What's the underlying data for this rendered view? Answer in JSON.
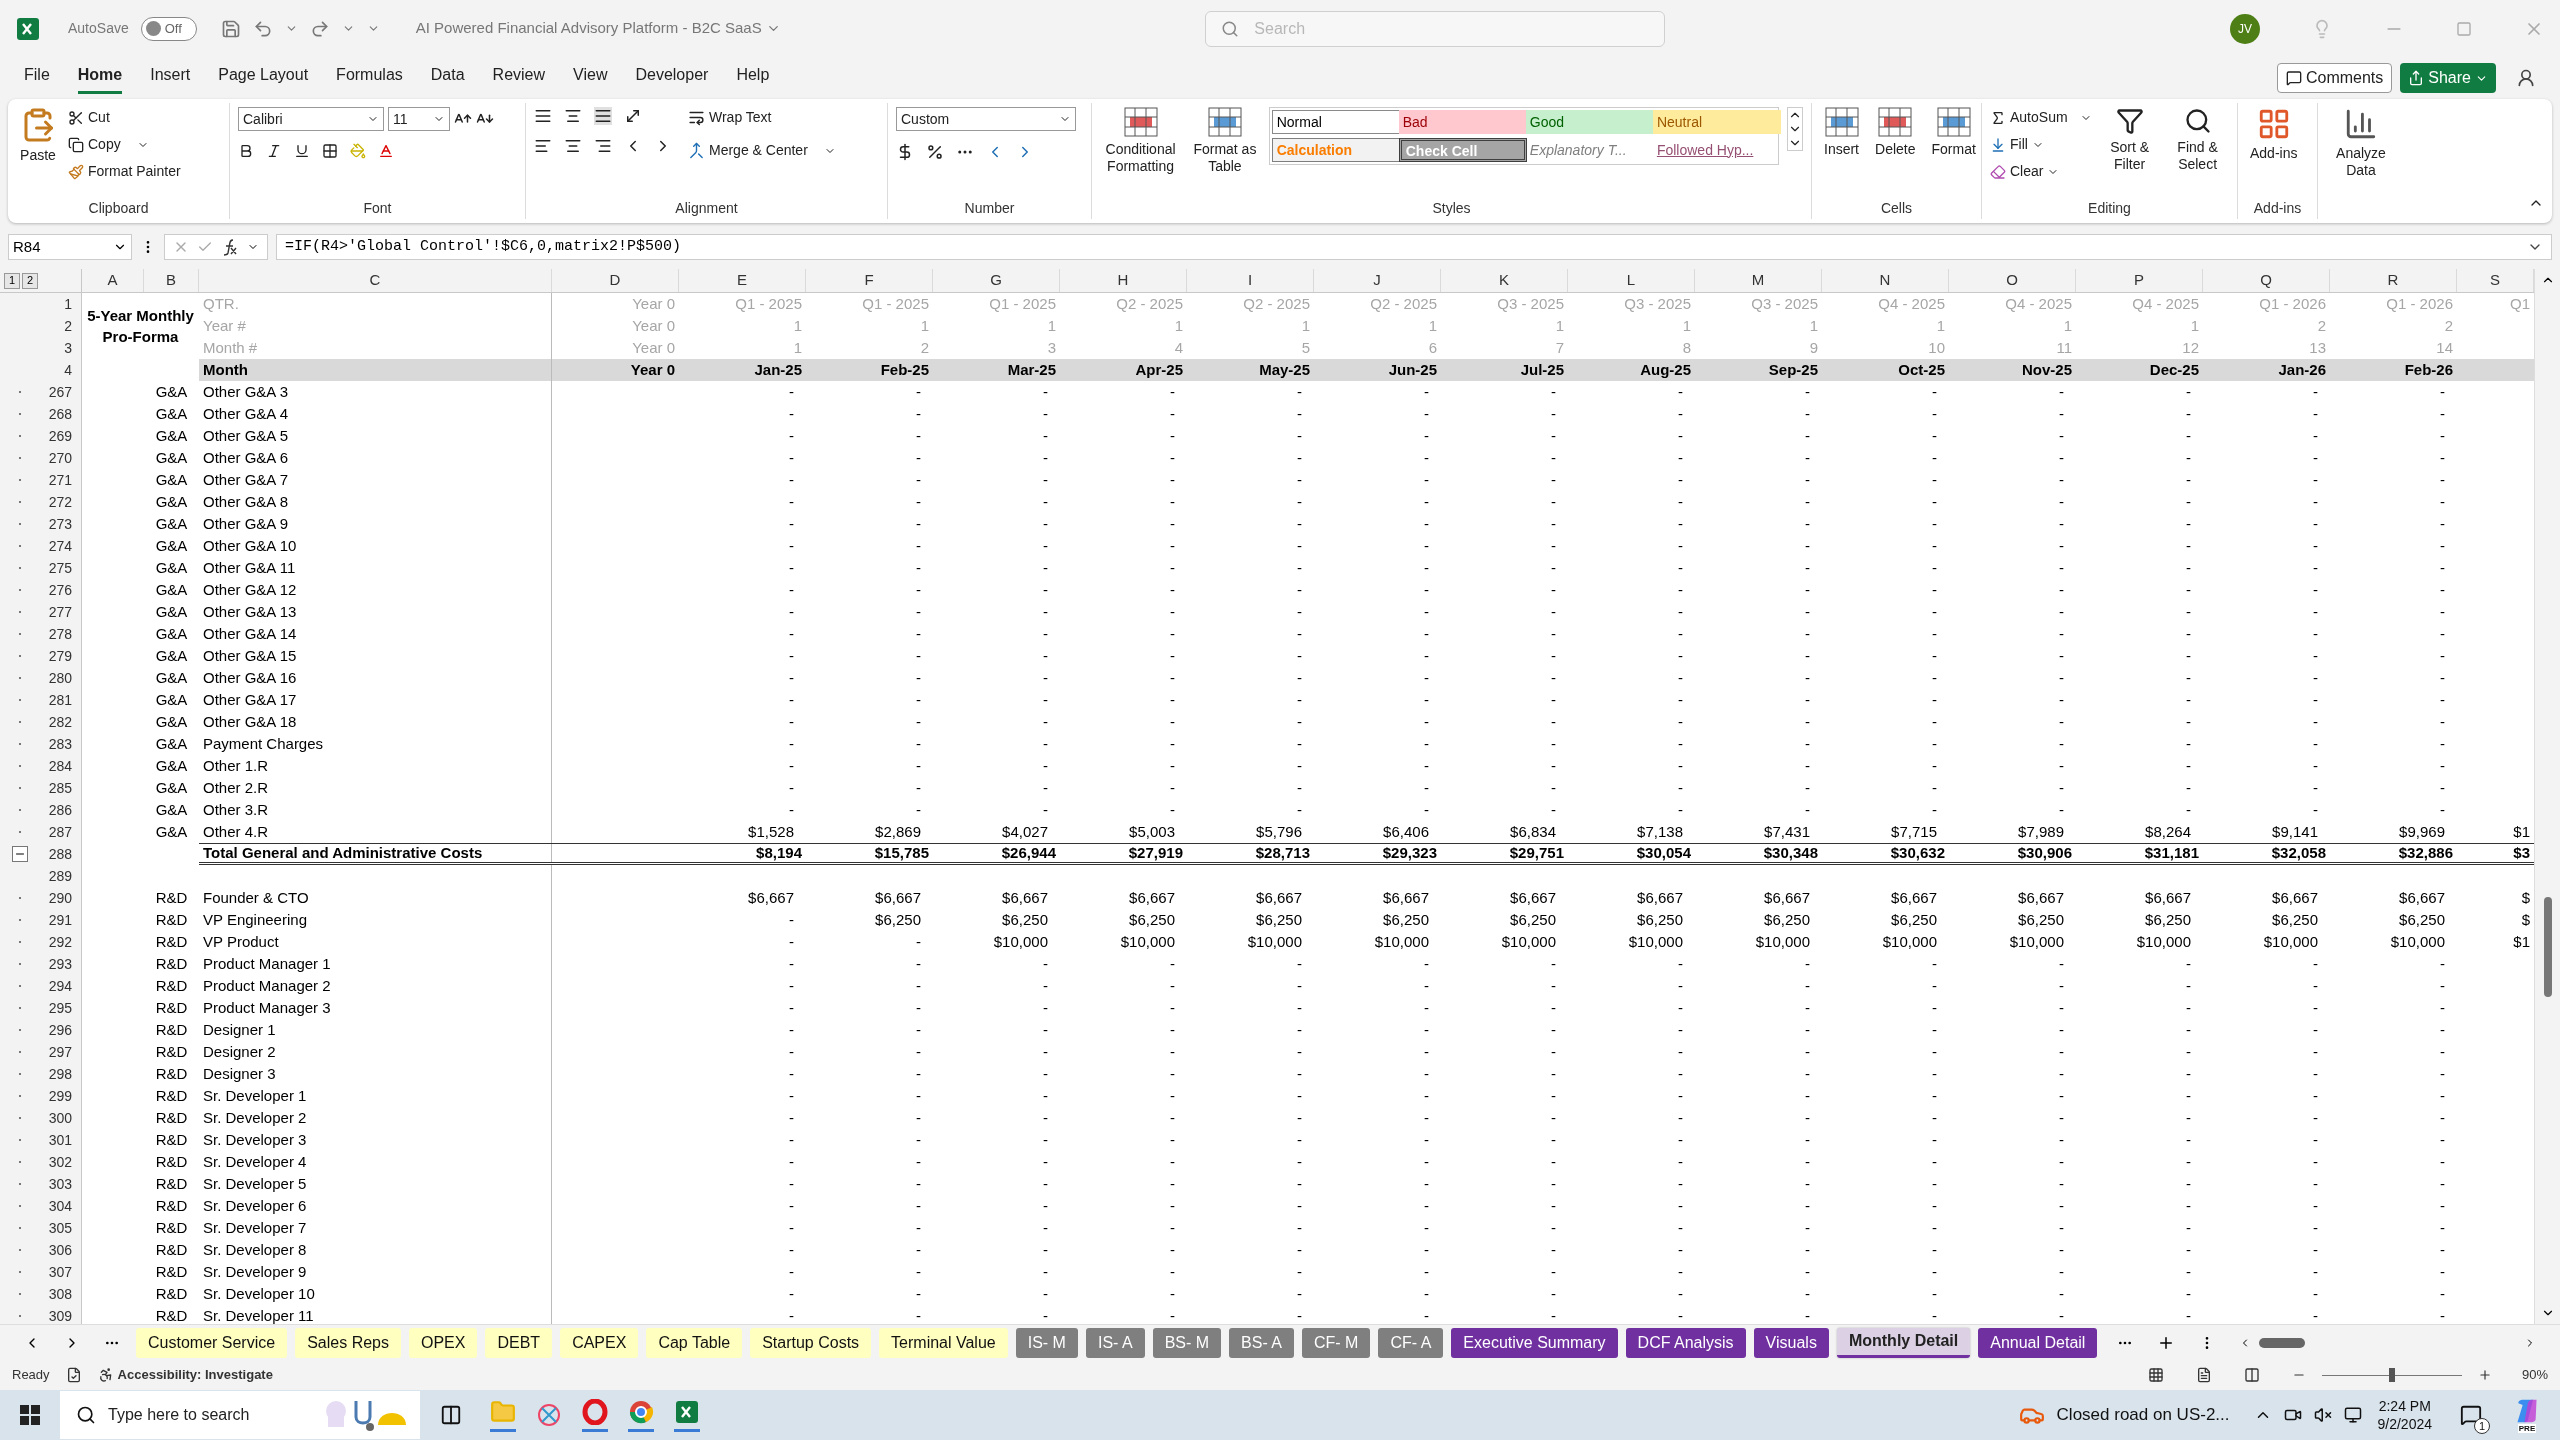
{
  "title_bar": {
    "autosave_label": "AutoSave",
    "autosave": {
      "label": "Off",
      "on": false
    },
    "document_title": "AI Powered Financial Advisory Platform - B2C SaaS",
    "search_placeholder": "Search",
    "avatar": "JV"
  },
  "menu_tabs": [
    {
      "label": "File",
      "selected": false
    },
    {
      "label": "Home",
      "selected": true
    },
    {
      "label": "Insert",
      "selected": false
    },
    {
      "label": "Page Layout",
      "selected": false
    },
    {
      "label": "Formulas",
      "selected": false
    },
    {
      "label": "Data",
      "selected": false
    },
    {
      "label": "Review",
      "selected": false
    },
    {
      "label": "View",
      "selected": false
    },
    {
      "label": "Developer",
      "selected": false
    },
    {
      "label": "Help",
      "selected": false
    }
  ],
  "comments_button": "Comments",
  "share_button": "Share",
  "ribbon": {
    "clipboard": {
      "group": "Clipboard",
      "paste": "Paste",
      "cut": "Cut",
      "copy": "Copy",
      "format_painter": "Format Painter"
    },
    "font": {
      "group": "Font",
      "name": "Calibri",
      "size": "11"
    },
    "alignment": {
      "group": "Alignment",
      "wrap": "Wrap Text",
      "merge": "Merge & Center"
    },
    "number": {
      "group": "Number",
      "format": "Custom"
    },
    "styles": {
      "group": "Styles",
      "conditional": "Conditional Formatting",
      "format_table": "Format as Table",
      "cells": [
        {
          "label": "Normal",
          "kind": "normal"
        },
        {
          "label": "Bad",
          "kind": "bad"
        },
        {
          "label": "Good",
          "kind": "good"
        },
        {
          "label": "Neutral",
          "kind": "neutral"
        },
        {
          "label": "Calculation",
          "kind": "calculation"
        },
        {
          "label": "Check Cell",
          "kind": "check"
        },
        {
          "label": "Explanatory T...",
          "kind": "explanatory"
        },
        {
          "label": "Followed Hyp...",
          "kind": "hyperlink"
        }
      ]
    },
    "cells": {
      "group": "Cells",
      "insert": "Insert",
      "delete": "Delete",
      "format": "Format"
    },
    "editing": {
      "group": "Editing",
      "autosum": "AutoSum",
      "fill": "Fill",
      "clear": "Clear",
      "sort": "Sort & Filter",
      "find": "Find & Select"
    },
    "addins": {
      "group": "Add-ins",
      "addins": "Add-ins",
      "analyze": "Analyze Data"
    }
  },
  "formula_bar": {
    "name_box": "R84",
    "formula": "=IF(R4>'Global Control'!$C6,0,matrix2!P$500)"
  },
  "outline_levels": [
    "1",
    "2"
  ],
  "columns": [
    "A",
    "B",
    "C",
    "D",
    "E",
    "F",
    "G",
    "H",
    "I",
    "J",
    "K",
    "L",
    "M",
    "N",
    "O",
    "P",
    "Q",
    "R",
    "S"
  ],
  "title_cell": "5-Year Monthly Pro-Forma",
  "header_rows": [
    {
      "num": "1",
      "label": "QTR.",
      "year": "Year 0",
      "kind": "info",
      "values": [
        "Q1 - 2025",
        "Q1 - 2025",
        "Q1 - 2025",
        "Q2 - 2025",
        "Q2 - 2025",
        "Q2 - 2025",
        "Q3 - 2025",
        "Q3 - 2025",
        "Q3 - 2025",
        "Q4 - 2025",
        "Q4 - 2025",
        "Q4 - 2025",
        "Q1 - 2026",
        "Q1 - 2026"
      ],
      "col_s": "Q1"
    },
    {
      "num": "2",
      "label": "Year #",
      "year": "Year 0",
      "kind": "info",
      "values": [
        "1",
        "1",
        "1",
        "1",
        "1",
        "1",
        "1",
        "1",
        "1",
        "1",
        "1",
        "1",
        "2",
        "2"
      ]
    },
    {
      "num": "3",
      "label": "Month #",
      "year": "Year 0",
      "kind": "info",
      "values": [
        "1",
        "2",
        "3",
        "4",
        "5",
        "6",
        "7",
        "8",
        "9",
        "10",
        "11",
        "12",
        "13",
        "14"
      ]
    },
    {
      "num": "4",
      "label": "Month",
      "year": "Year 0",
      "kind": "month",
      "values": [
        "Jan-25",
        "Feb-25",
        "Mar-25",
        "Apr-25",
        "May-25",
        "Jun-25",
        "Jul-25",
        "Aug-25",
        "Sep-25",
        "Oct-25",
        "Nov-25",
        "Dec-25",
        "Jan-26",
        "Feb-26"
      ]
    }
  ],
  "rows": [
    {
      "num": "267",
      "kind": "item",
      "category": "G&A",
      "label": "Other G&A 3",
      "values": [
        "-",
        "-",
        "-",
        "-",
        "-",
        "-",
        "-",
        "-",
        "-",
        "-",
        "-",
        "-",
        "-",
        "-"
      ]
    },
    {
      "num": "268",
      "kind": "item",
      "category": "G&A",
      "label": "Other G&A 4",
      "values": [
        "-",
        "-",
        "-",
        "-",
        "-",
        "-",
        "-",
        "-",
        "-",
        "-",
        "-",
        "-",
        "-",
        "-"
      ]
    },
    {
      "num": "269",
      "kind": "item",
      "category": "G&A",
      "label": "Other G&A 5",
      "values": [
        "-",
        "-",
        "-",
        "-",
        "-",
        "-",
        "-",
        "-",
        "-",
        "-",
        "-",
        "-",
        "-",
        "-"
      ]
    },
    {
      "num": "270",
      "kind": "item",
      "category": "G&A",
      "label": "Other G&A 6",
      "values": [
        "-",
        "-",
        "-",
        "-",
        "-",
        "-",
        "-",
        "-",
        "-",
        "-",
        "-",
        "-",
        "-",
        "-"
      ]
    },
    {
      "num": "271",
      "kind": "item",
      "category": "G&A",
      "label": "Other G&A 7",
      "values": [
        "-",
        "-",
        "-",
        "-",
        "-",
        "-",
        "-",
        "-",
        "-",
        "-",
        "-",
        "-",
        "-",
        "-"
      ]
    },
    {
      "num": "272",
      "kind": "item",
      "category": "G&A",
      "label": "Other G&A 8",
      "values": [
        "-",
        "-",
        "-",
        "-",
        "-",
        "-",
        "-",
        "-",
        "-",
        "-",
        "-",
        "-",
        "-",
        "-"
      ]
    },
    {
      "num": "273",
      "kind": "item",
      "category": "G&A",
      "label": "Other G&A 9",
      "values": [
        "-",
        "-",
        "-",
        "-",
        "-",
        "-",
        "-",
        "-",
        "-",
        "-",
        "-",
        "-",
        "-",
        "-"
      ]
    },
    {
      "num": "274",
      "kind": "item",
      "category": "G&A",
      "label": "Other G&A 10",
      "values": [
        "-",
        "-",
        "-",
        "-",
        "-",
        "-",
        "-",
        "-",
        "-",
        "-",
        "-",
        "-",
        "-",
        "-"
      ]
    },
    {
      "num": "275",
      "kind": "item",
      "category": "G&A",
      "label": "Other G&A 11",
      "values": [
        "-",
        "-",
        "-",
        "-",
        "-",
        "-",
        "-",
        "-",
        "-",
        "-",
        "-",
        "-",
        "-",
        "-"
      ]
    },
    {
      "num": "276",
      "kind": "item",
      "category": "G&A",
      "label": "Other G&A 12",
      "values": [
        "-",
        "-",
        "-",
        "-",
        "-",
        "-",
        "-",
        "-",
        "-",
        "-",
        "-",
        "-",
        "-",
        "-"
      ]
    },
    {
      "num": "277",
      "kind": "item",
      "category": "G&A",
      "label": "Other G&A 13",
      "values": [
        "-",
        "-",
        "-",
        "-",
        "-",
        "-",
        "-",
        "-",
        "-",
        "-",
        "-",
        "-",
        "-",
        "-"
      ]
    },
    {
      "num": "278",
      "kind": "item",
      "category": "G&A",
      "label": "Other G&A 14",
      "values": [
        "-",
        "-",
        "-",
        "-",
        "-",
        "-",
        "-",
        "-",
        "-",
        "-",
        "-",
        "-",
        "-",
        "-"
      ]
    },
    {
      "num": "279",
      "kind": "item",
      "category": "G&A",
      "label": "Other G&A 15",
      "values": [
        "-",
        "-",
        "-",
        "-",
        "-",
        "-",
        "-",
        "-",
        "-",
        "-",
        "-",
        "-",
        "-",
        "-"
      ]
    },
    {
      "num": "280",
      "kind": "item",
      "category": "G&A",
      "label": "Other G&A 16",
      "values": [
        "-",
        "-",
        "-",
        "-",
        "-",
        "-",
        "-",
        "-",
        "-",
        "-",
        "-",
        "-",
        "-",
        "-"
      ]
    },
    {
      "num": "281",
      "kind": "item",
      "category": "G&A",
      "label": "Other G&A 17",
      "values": [
        "-",
        "-",
        "-",
        "-",
        "-",
        "-",
        "-",
        "-",
        "-",
        "-",
        "-",
        "-",
        "-",
        "-"
      ]
    },
    {
      "num": "282",
      "kind": "item",
      "category": "G&A",
      "label": "Other G&A 18",
      "values": [
        "-",
        "-",
        "-",
        "-",
        "-",
        "-",
        "-",
        "-",
        "-",
        "-",
        "-",
        "-",
        "-",
        "-"
      ]
    },
    {
      "num": "283",
      "kind": "item",
      "category": "G&A",
      "label": "Payment Charges",
      "values": [
        "-",
        "-",
        "-",
        "-",
        "-",
        "-",
        "-",
        "-",
        "-",
        "-",
        "-",
        "-",
        "-",
        "-"
      ]
    },
    {
      "num": "284",
      "kind": "item",
      "category": "G&A",
      "label": "Other 1.R",
      "values": [
        "-",
        "-",
        "-",
        "-",
        "-",
        "-",
        "-",
        "-",
        "-",
        "-",
        "-",
        "-",
        "-",
        "-"
      ]
    },
    {
      "num": "285",
      "kind": "item",
      "category": "G&A",
      "label": "Other 2.R",
      "values": [
        "-",
        "-",
        "-",
        "-",
        "-",
        "-",
        "-",
        "-",
        "-",
        "-",
        "-",
        "-",
        "-",
        "-"
      ]
    },
    {
      "num": "286",
      "kind": "item",
      "category": "G&A",
      "label": "Other 3.R",
      "values": [
        "-",
        "-",
        "-",
        "-",
        "-",
        "-",
        "-",
        "-",
        "-",
        "-",
        "-",
        "-",
        "-",
        "-"
      ]
    },
    {
      "num": "287",
      "kind": "item",
      "category": "G&A",
      "label": "Other 4.R",
      "values": [
        "$1,528",
        "$2,869",
        "$4,027",
        "$5,003",
        "$5,796",
        "$6,406",
        "$6,834",
        "$7,138",
        "$7,431",
        "$7,715",
        "$7,989",
        "$8,264",
        "$9,141",
        "$9,969"
      ],
      "col_s": "$1"
    },
    {
      "num": "288",
      "kind": "total",
      "label": "Total General and Administrative Costs",
      "values": [
        "$8,194",
        "$15,785",
        "$26,944",
        "$27,919",
        "$28,713",
        "$29,323",
        "$29,751",
        "$30,054",
        "$30,348",
        "$30,632",
        "$30,906",
        "$31,181",
        "$32,058",
        "$32,886"
      ],
      "col_s": "$3"
    },
    {
      "num": "289",
      "kind": "blank"
    },
    {
      "num": "290",
      "kind": "item",
      "category": "R&D",
      "label": "Founder & CTO",
      "values": [
        "$6,667",
        "$6,667",
        "$6,667",
        "$6,667",
        "$6,667",
        "$6,667",
        "$6,667",
        "$6,667",
        "$6,667",
        "$6,667",
        "$6,667",
        "$6,667",
        "$6,667",
        "$6,667"
      ],
      "col_s": "$"
    },
    {
      "num": "291",
      "kind": "item",
      "category": "R&D",
      "label": "VP Engineering",
      "values": [
        "-",
        "$6,250",
        "$6,250",
        "$6,250",
        "$6,250",
        "$6,250",
        "$6,250",
        "$6,250",
        "$6,250",
        "$6,250",
        "$6,250",
        "$6,250",
        "$6,250",
        "$6,250"
      ],
      "col_s": "$"
    },
    {
      "num": "292",
      "kind": "item",
      "category": "R&D",
      "label": "VP Product",
      "values": [
        "-",
        "-",
        "$10,000",
        "$10,000",
        "$10,000",
        "$10,000",
        "$10,000",
        "$10,000",
        "$10,000",
        "$10,000",
        "$10,000",
        "$10,000",
        "$10,000",
        "$10,000"
      ],
      "col_s": "$1"
    },
    {
      "num": "293",
      "kind": "item",
      "category": "R&D",
      "label": "Product Manager 1",
      "values": [
        "-",
        "-",
        "-",
        "-",
        "-",
        "-",
        "-",
        "-",
        "-",
        "-",
        "-",
        "-",
        "-",
        "-"
      ]
    },
    {
      "num": "294",
      "kind": "item",
      "category": "R&D",
      "label": "Product Manager 2",
      "values": [
        "-",
        "-",
        "-",
        "-",
        "-",
        "-",
        "-",
        "-",
        "-",
        "-",
        "-",
        "-",
        "-",
        "-"
      ]
    },
    {
      "num": "295",
      "kind": "item",
      "category": "R&D",
      "label": "Product Manager 3",
      "values": [
        "-",
        "-",
        "-",
        "-",
        "-",
        "-",
        "-",
        "-",
        "-",
        "-",
        "-",
        "-",
        "-",
        "-"
      ]
    },
    {
      "num": "296",
      "kind": "item",
      "category": "R&D",
      "label": "Designer 1",
      "values": [
        "-",
        "-",
        "-",
        "-",
        "-",
        "-",
        "-",
        "-",
        "-",
        "-",
        "-",
        "-",
        "-",
        "-"
      ]
    },
    {
      "num": "297",
      "kind": "item",
      "category": "R&D",
      "label": "Designer 2",
      "values": [
        "-",
        "-",
        "-",
        "-",
        "-",
        "-",
        "-",
        "-",
        "-",
        "-",
        "-",
        "-",
        "-",
        "-"
      ]
    },
    {
      "num": "298",
      "kind": "item",
      "category": "R&D",
      "label": "Designer 3",
      "values": [
        "-",
        "-",
        "-",
        "-",
        "-",
        "-",
        "-",
        "-",
        "-",
        "-",
        "-",
        "-",
        "-",
        "-"
      ]
    },
    {
      "num": "299",
      "kind": "item",
      "category": "R&D",
      "label": "Sr. Developer 1",
      "values": [
        "-",
        "-",
        "-",
        "-",
        "-",
        "-",
        "-",
        "-",
        "-",
        "-",
        "-",
        "-",
        "-",
        "-"
      ]
    },
    {
      "num": "300",
      "kind": "item",
      "category": "R&D",
      "label": "Sr. Developer 2",
      "values": [
        "-",
        "-",
        "-",
        "-",
        "-",
        "-",
        "-",
        "-",
        "-",
        "-",
        "-",
        "-",
        "-",
        "-"
      ]
    },
    {
      "num": "301",
      "kind": "item",
      "category": "R&D",
      "label": "Sr. Developer 3",
      "values": [
        "-",
        "-",
        "-",
        "-",
        "-",
        "-",
        "-",
        "-",
        "-",
        "-",
        "-",
        "-",
        "-",
        "-"
      ]
    },
    {
      "num": "302",
      "kind": "item",
      "category": "R&D",
      "label": "Sr. Developer 4",
      "values": [
        "-",
        "-",
        "-",
        "-",
        "-",
        "-",
        "-",
        "-",
        "-",
        "-",
        "-",
        "-",
        "-",
        "-"
      ]
    },
    {
      "num": "303",
      "kind": "item",
      "category": "R&D",
      "label": "Sr. Developer 5",
      "values": [
        "-",
        "-",
        "-",
        "-",
        "-",
        "-",
        "-",
        "-",
        "-",
        "-",
        "-",
        "-",
        "-",
        "-"
      ]
    },
    {
      "num": "304",
      "kind": "item",
      "category": "R&D",
      "label": "Sr. Developer 6",
      "values": [
        "-",
        "-",
        "-",
        "-",
        "-",
        "-",
        "-",
        "-",
        "-",
        "-",
        "-",
        "-",
        "-",
        "-"
      ]
    },
    {
      "num": "305",
      "kind": "item",
      "category": "R&D",
      "label": "Sr. Developer 7",
      "values": [
        "-",
        "-",
        "-",
        "-",
        "-",
        "-",
        "-",
        "-",
        "-",
        "-",
        "-",
        "-",
        "-",
        "-"
      ]
    },
    {
      "num": "306",
      "kind": "item",
      "category": "R&D",
      "label": "Sr. Developer 8",
      "values": [
        "-",
        "-",
        "-",
        "-",
        "-",
        "-",
        "-",
        "-",
        "-",
        "-",
        "-",
        "-",
        "-",
        "-"
      ]
    },
    {
      "num": "307",
      "kind": "item",
      "category": "R&D",
      "label": "Sr. Developer 9",
      "values": [
        "-",
        "-",
        "-",
        "-",
        "-",
        "-",
        "-",
        "-",
        "-",
        "-",
        "-",
        "-",
        "-",
        "-"
      ]
    },
    {
      "num": "308",
      "kind": "item",
      "category": "R&D",
      "label": "Sr. Developer 10",
      "values": [
        "-",
        "-",
        "-",
        "-",
        "-",
        "-",
        "-",
        "-",
        "-",
        "-",
        "-",
        "-",
        "-",
        "-"
      ]
    },
    {
      "num": "309",
      "kind": "item",
      "category": "R&D",
      "label": "Sr. Developer 11",
      "values": [
        "-",
        "-",
        "-",
        "-",
        "-",
        "-",
        "-",
        "-",
        "-",
        "-",
        "-",
        "-",
        "-",
        "-"
      ]
    }
  ],
  "sheet_tabs": [
    {
      "label": "Customer Service",
      "color": "#ffffc0",
      "selected": false
    },
    {
      "label": "Sales Reps",
      "color": "#ffffc0",
      "selected": false
    },
    {
      "label": "OPEX",
      "color": "#ffffc0",
      "selected": false
    },
    {
      "label": "DEBT",
      "color": "#ffffc0",
      "selected": false
    },
    {
      "label": "CAPEX",
      "color": "#ffffc0",
      "selected": false
    },
    {
      "label": "Cap Table",
      "color": "#ffffc0",
      "selected": false
    },
    {
      "label": "Startup Costs",
      "color": "#ffffc0",
      "selected": false
    },
    {
      "label": "Terminal Value",
      "color": "#ffffc0",
      "selected": false
    },
    {
      "label": "IS- M",
      "color": "#7f7f7f",
      "selected": false
    },
    {
      "label": "IS- A",
      "color": "#7f7f7f",
      "selected": false
    },
    {
      "label": "BS- M",
      "color": "#7f7f7f",
      "selected": false
    },
    {
      "label": "BS- A",
      "color": "#7f7f7f",
      "selected": false
    },
    {
      "label": "CF- M",
      "color": "#7f7f7f",
      "selected": false
    },
    {
      "label": "CF- A",
      "color": "#7f7f7f",
      "selected": false
    },
    {
      "label": "Executive Summary",
      "color": "#7030a0",
      "selected": false
    },
    {
      "label": "DCF Analysis",
      "color": "#7030a0",
      "selected": false
    },
    {
      "label": "Visuals",
      "color": "#7030a0",
      "selected": false
    },
    {
      "label": "Monthly Detail",
      "color": "#7030a0",
      "selected": true
    },
    {
      "label": "Annual Detail",
      "color": "#7030a0",
      "selected": false
    }
  ],
  "status_bar": {
    "status": "Ready",
    "accessibility": "Accessibility: Investigate",
    "zoom": {
      "label": "90%",
      "level": 0.5
    }
  },
  "taskbar": {
    "search_placeholder": "Type here to search",
    "notification": "Closed road on US-2...",
    "time": "2:24 PM",
    "date": "9/2/2024",
    "message_count": "1",
    "copilot_badge": "PRE"
  }
}
